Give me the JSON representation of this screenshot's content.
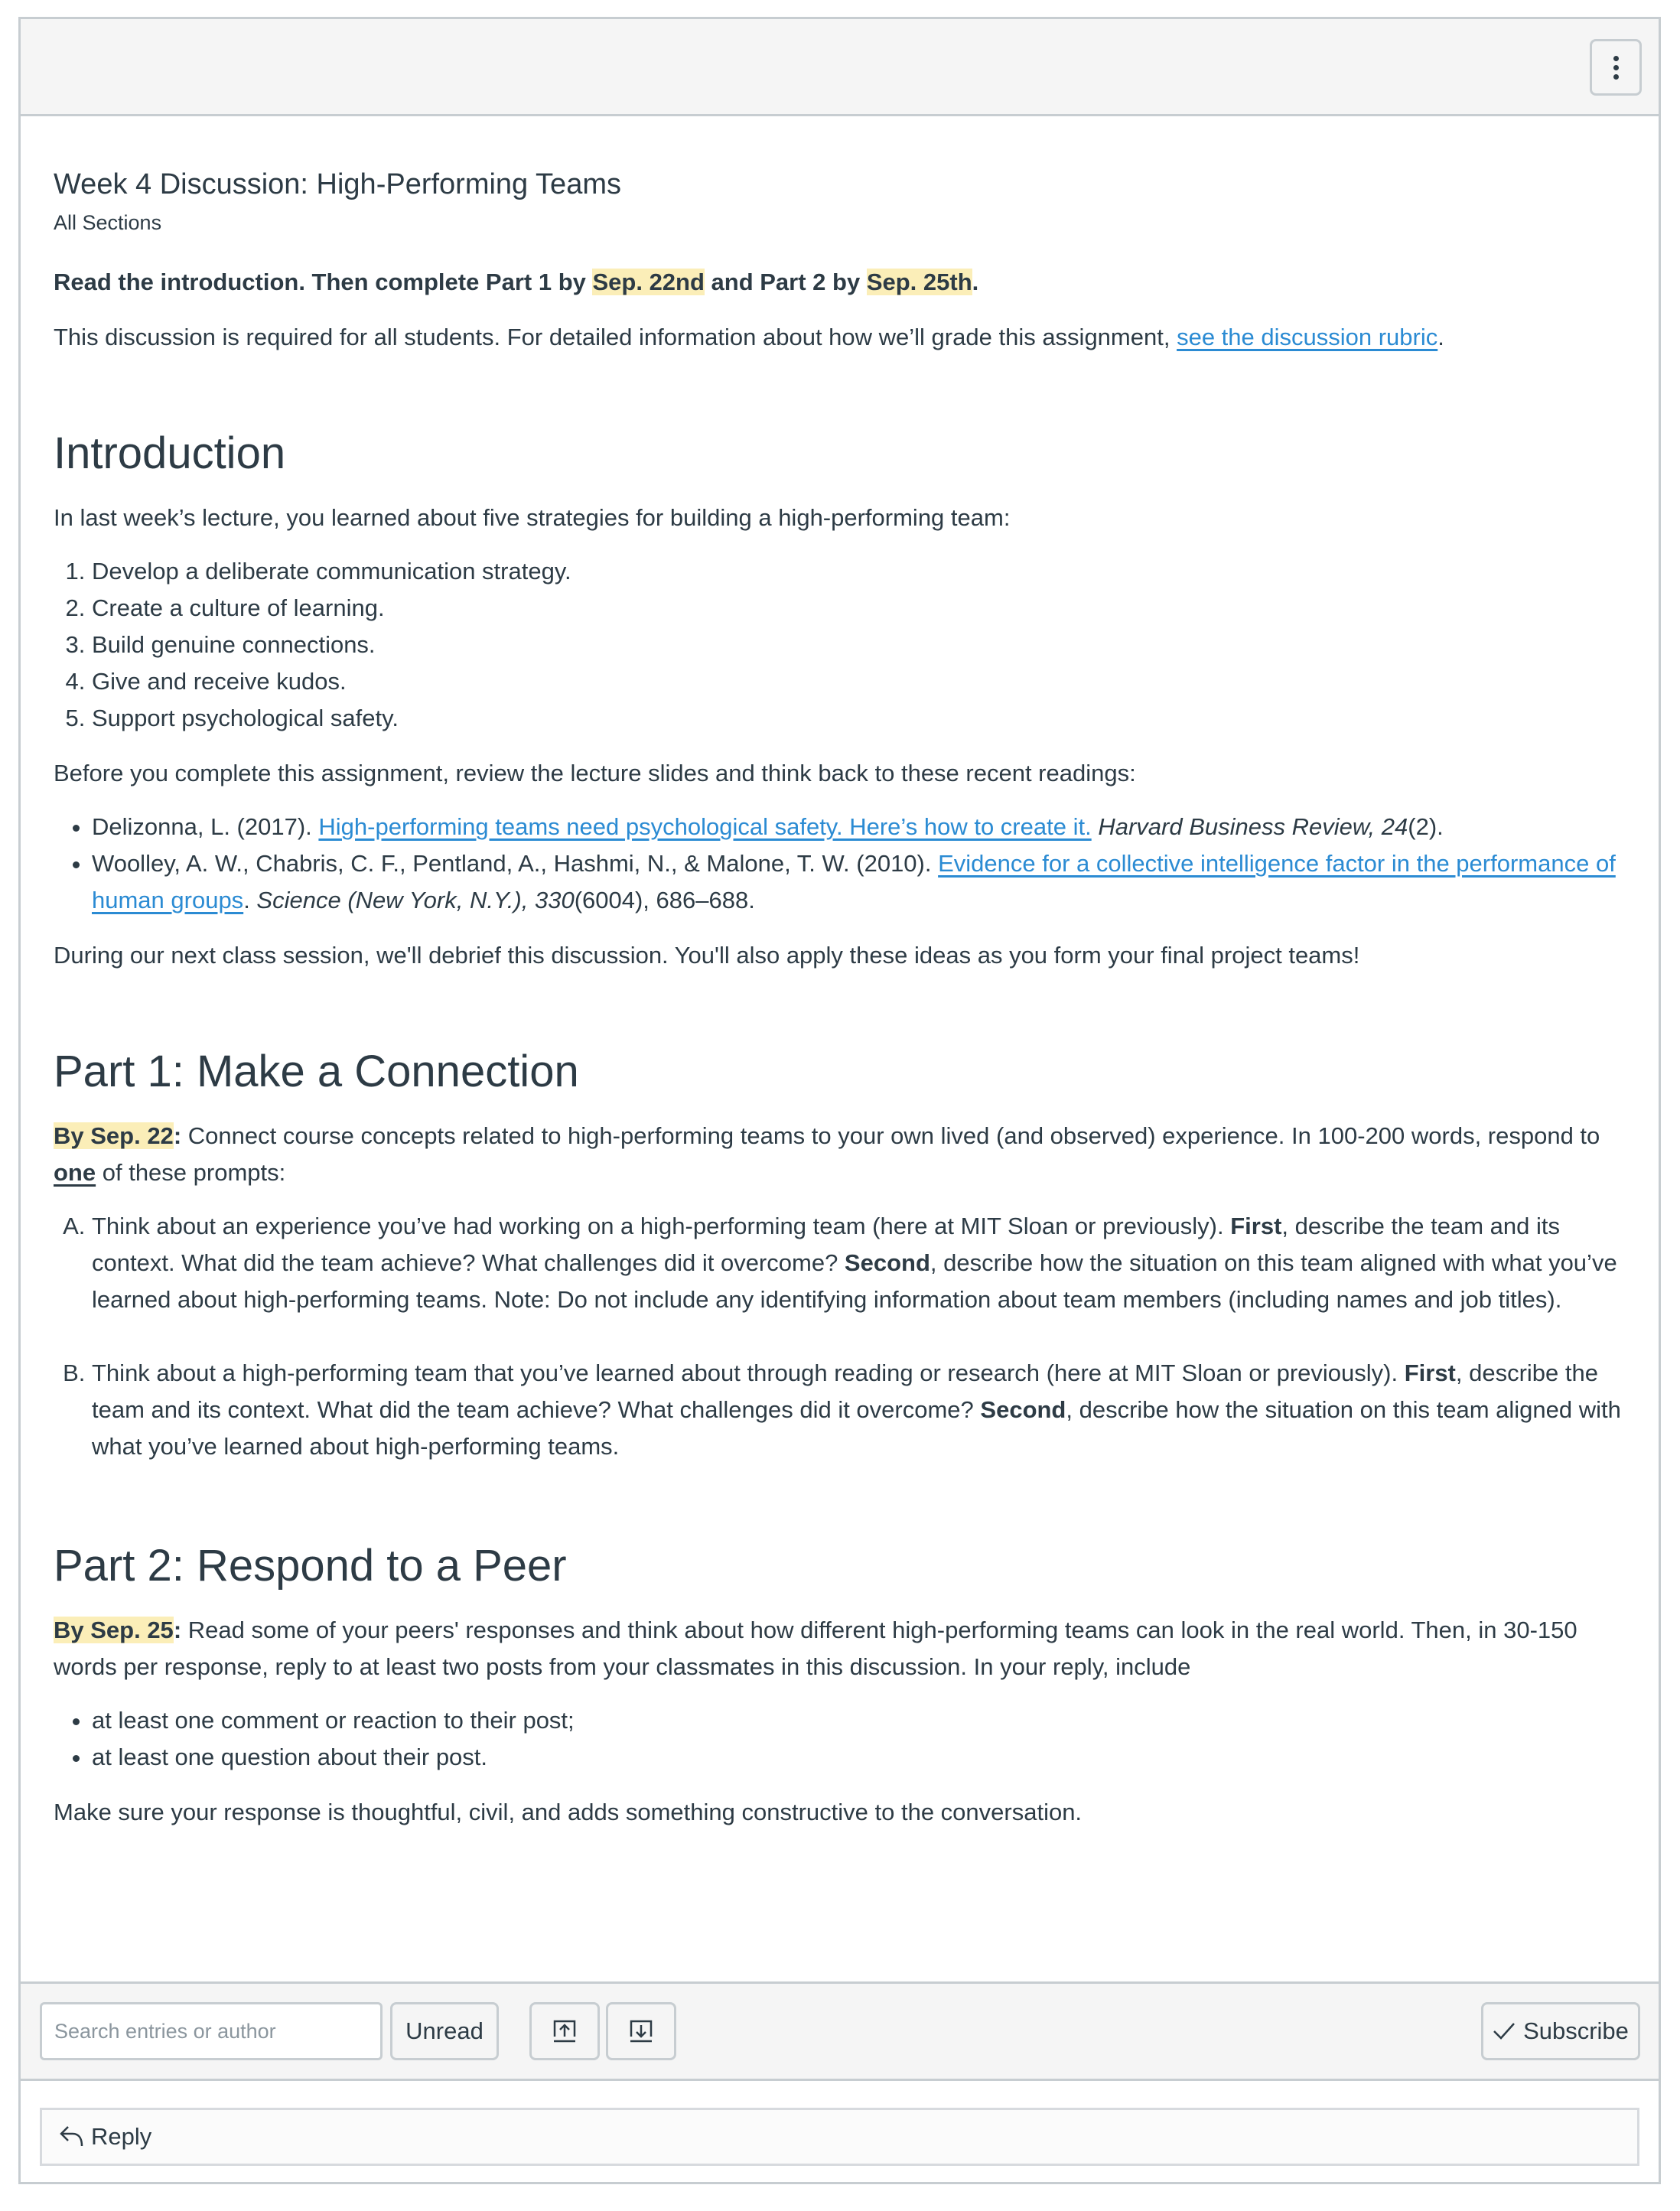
{
  "header": {
    "more_options_icon": "kebab-vertical-icon"
  },
  "discussion": {
    "title": "Week 4 Discussion: High-Performing Teams",
    "sections_label": "All Sections",
    "lead": {
      "part1": "Read the introduction. Then complete Part 1 by ",
      "date1": "Sep. 22nd",
      "part2": " and Part 2 by ",
      "date2": "Sep. 25th",
      "end": "."
    },
    "required": {
      "text": "This discussion is required for all students. For detailed information about how we’ll grade this assignment, ",
      "link": "see the discussion rubric",
      "end": "."
    },
    "introduction": {
      "heading": "Introduction",
      "intro_text": "In last week’s lecture, you learned about five strategies for building a high-performing team:",
      "strategies": [
        "Develop a deliberate communication strategy.",
        "Create a culture of learning.",
        "Build genuine connections.",
        "Give and receive kudos.",
        "Support psychological safety."
      ],
      "readings_intro": "Before you complete this assignment, review the lecture slides and think back to these recent readings:",
      "readings": [
        {
          "authors": "Delizonna, L. (2017). ",
          "link": "High-performing teams need psychological safety. Here’s how to create it.",
          "after_link": " ",
          "journal": "Harvard Business Review, 24",
          "tail": "(2)."
        },
        {
          "authors": "Woolley, A. W., Chabris, C. F., Pentland, A., Hashmi, N., & Malone, T. W. (2010). ",
          "link": "Evidence for a collective intelligence factor in the performance of human groups",
          "after_link": ". ",
          "journal": "Science (New York, N.Y.), 330",
          "tail": "(6004), 686–688."
        }
      ],
      "closing": "During our next class session, we'll debrief this discussion. You'll also apply these ideas as you form your final project teams!"
    },
    "part1": {
      "heading": "Part 1: Make a Connection",
      "due": "By Sep. 22",
      "due_colon": ":",
      "text_a": " Connect course concepts related to high-performing teams to your own lived (and observed) experience. In 100-200 words, respond to ",
      "emph": "one",
      "text_b": " of these prompts:",
      "prompts": [
        {
          "s1": "Think about an experience you’ve had working on a high-performing team (here at MIT Sloan or previously). ",
          "first": "First",
          "s2": ", describe the team and its context. What did the team achieve? What challenges did it overcome? ",
          "second": "Second",
          "s3": ", describe how the situation on this team aligned with what you’ve learned about high-performing teams. Note: Do not include any identifying information about team members (including names and job titles)."
        },
        {
          "s1": "Think about a high-performing team that you’ve learned about through reading or research (here at MIT Sloan or previously). ",
          "first": "First",
          "s2": ", describe the team and its context. What did the team achieve? What challenges did it overcome? ",
          "second": "Second",
          "s3": ", describe how the situation on this team aligned with what you’ve learned about high-performing teams."
        }
      ]
    },
    "part2": {
      "heading": "Part 2: Respond to a Peer",
      "due": "By Sep. 25",
      "due_colon": ":",
      "text": " Read some of your peers' responses and think about how different high-performing teams can look in the real world. Then, in 30-150 words per response, reply to at least two posts from your classmates in this discussion. In your reply, include",
      "requirements": [
        "at least one comment or reaction to their post;",
        "at least one question about their post."
      ],
      "closing": "Make sure your response is thoughtful, civil, and adds something constructive to the conversation."
    }
  },
  "toolbar": {
    "search_placeholder": "Search entries or author",
    "search_value": "",
    "unread_label": "Unread",
    "expand_icon": "upload-arrow-icon",
    "collapse_icon": "download-arrow-icon",
    "subscribe_label": "Subscribe",
    "subscribe_icon": "checkmark-icon"
  },
  "reply": {
    "label": "Reply",
    "icon": "reply-arrow-icon"
  },
  "colors": {
    "text": "#2D3B45",
    "link": "#2B8BD3",
    "highlight": "#FBEEB8",
    "border": "#C7CDD1",
    "toolbar_bg": "#F5F5F5"
  }
}
